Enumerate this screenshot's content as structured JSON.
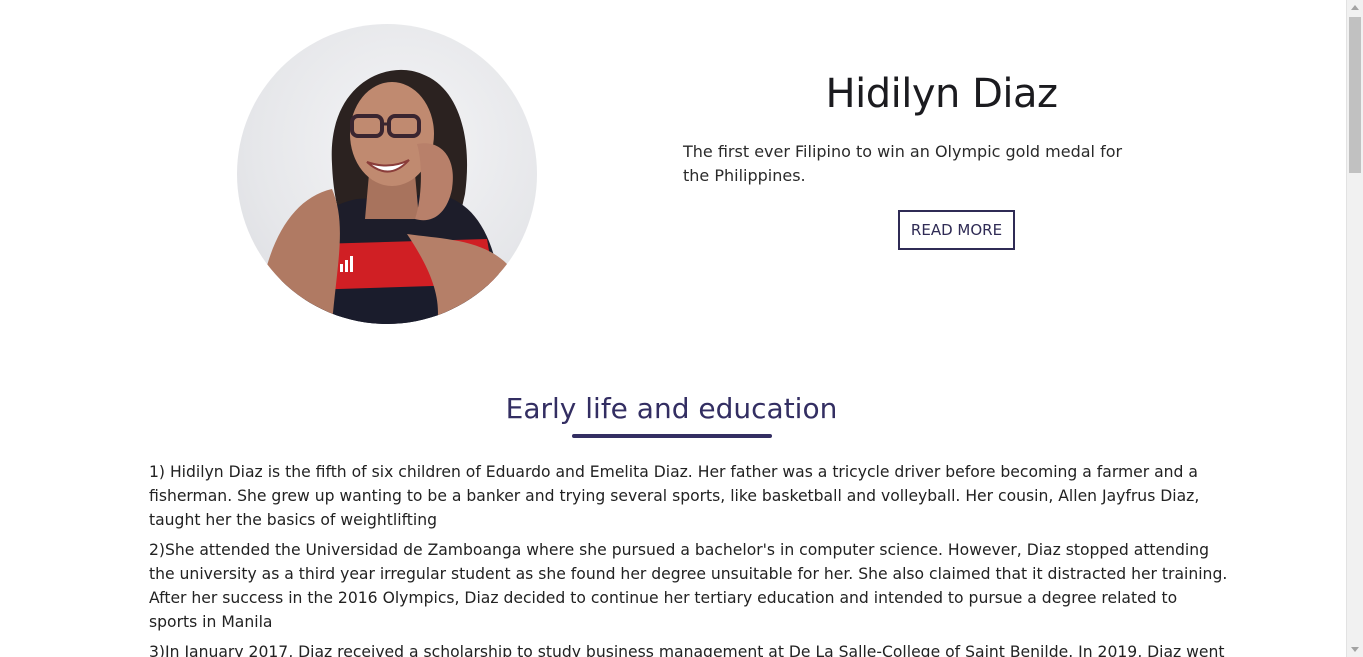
{
  "hero": {
    "title": "Hidilyn Diaz",
    "description": "The first ever Filipino to win an Olympic gold medal for the Philippines.",
    "read_more_label": "READ MORE"
  },
  "section": {
    "heading": "Early life and education",
    "paragraphs": [
      "1) Hidilyn Diaz is the fifth of six children of Eduardo and Emelita Diaz. Her father was a tricycle driver before becoming a farmer and a fisherman. She grew up wanting to be a banker and trying several sports, like basketball and volleyball. Her cousin, Allen Jayfrus Diaz, taught her the basics of weightlifting",
      "2)She attended the Universidad de Zamboanga where she pursued a bachelor's in computer science. However, Diaz stopped attending the university as a third year irregular student as she found her degree unsuitable for her. She also claimed that it distracted her training. After her success in the 2016 Olympics, Diaz decided to continue her tertiary education and intended to pursue a degree related to sports in Manila",
      "3)In January 2017, Diaz received a scholarship to study business management at De La Salle-College of Saint Benilde. In 2019, Diaz went"
    ]
  },
  "colors": {
    "accent": "#332e62",
    "button_border": "#2f2b55",
    "text": "#222222"
  }
}
